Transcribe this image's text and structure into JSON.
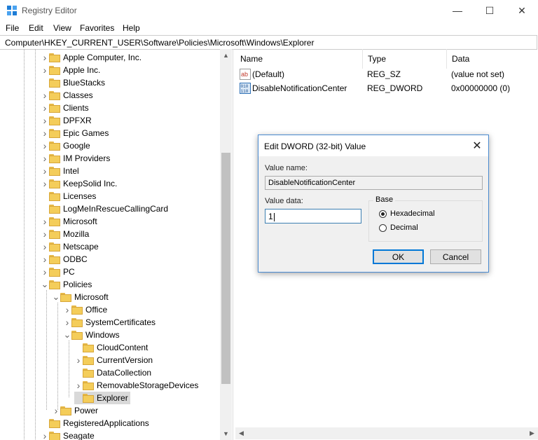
{
  "window": {
    "title": "Registry Editor",
    "minimize_glyph": "—",
    "maximize_glyph": "☐",
    "close_glyph": "✕"
  },
  "menu": [
    "File",
    "Edit",
    "View",
    "Favorites",
    "Help"
  ],
  "address": "Computer\\HKEY_CURRENT_USER\\Software\\Policies\\Microsoft\\Windows\\Explorer",
  "tree": [
    {
      "label": "Apple Computer, Inc.",
      "expander": "collapsed"
    },
    {
      "label": "Apple Inc.",
      "expander": "collapsed"
    },
    {
      "label": "BlueStacks",
      "expander": "none"
    },
    {
      "label": "Classes",
      "expander": "collapsed"
    },
    {
      "label": "Clients",
      "expander": "collapsed"
    },
    {
      "label": "DPFXR",
      "expander": "collapsed"
    },
    {
      "label": "Epic Games",
      "expander": "collapsed"
    },
    {
      "label": "Google",
      "expander": "collapsed"
    },
    {
      "label": "IM Providers",
      "expander": "collapsed"
    },
    {
      "label": "Intel",
      "expander": "collapsed"
    },
    {
      "label": "KeepSolid Inc.",
      "expander": "collapsed"
    },
    {
      "label": "Licenses",
      "expander": "none"
    },
    {
      "label": "LogMeInRescueCallingCard",
      "expander": "none"
    },
    {
      "label": "Microsoft",
      "expander": "collapsed"
    },
    {
      "label": "Mozilla",
      "expander": "collapsed"
    },
    {
      "label": "Netscape",
      "expander": "collapsed"
    },
    {
      "label": "ODBC",
      "expander": "collapsed"
    },
    {
      "label": "PC",
      "expander": "collapsed"
    },
    {
      "label": "Policies",
      "expander": "expanded"
    },
    {
      "label": "Microsoft",
      "expander": "expanded"
    },
    {
      "label": "Office",
      "expander": "collapsed"
    },
    {
      "label": "SystemCertificates",
      "expander": "collapsed"
    },
    {
      "label": "Windows",
      "expander": "expanded"
    },
    {
      "label": "CloudContent",
      "expander": "none"
    },
    {
      "label": "CurrentVersion",
      "expander": "collapsed"
    },
    {
      "label": "DataCollection",
      "expander": "none"
    },
    {
      "label": "RemovableStorageDevices",
      "expander": "collapsed"
    },
    {
      "label": "Explorer",
      "expander": "none",
      "selected": true
    },
    {
      "label": "Power",
      "expander": "collapsed"
    },
    {
      "label": "RegisteredApplications",
      "expander": "none"
    },
    {
      "label": "Seagate",
      "expander": "collapsed"
    }
  ],
  "list": {
    "headers": {
      "name": "Name",
      "type": "Type",
      "data": "Data"
    },
    "rows": [
      {
        "icon": "ab",
        "name": "(Default)",
        "type": "REG_SZ",
        "data": "(value not set)"
      },
      {
        "icon": "010",
        "name": "DisableNotificationCenter",
        "type": "REG_DWORD",
        "data": "0x00000000 (0)"
      }
    ]
  },
  "dialog": {
    "title": "Edit DWORD (32-bit) Value",
    "close_glyph": "✕",
    "value_name_label": "Value name:",
    "value_name": "DisableNotificationCenter",
    "value_data_label": "Value data:",
    "value_data": "1",
    "base_label": "Base",
    "hex_label": "Hexadecimal",
    "dec_label": "Decimal",
    "selected_base": "hex",
    "ok_label": "OK",
    "cancel_label": "Cancel"
  },
  "colors": {
    "folder": "#f4cd5a",
    "accent": "#0078d7",
    "selection": "#d9d9d9"
  }
}
